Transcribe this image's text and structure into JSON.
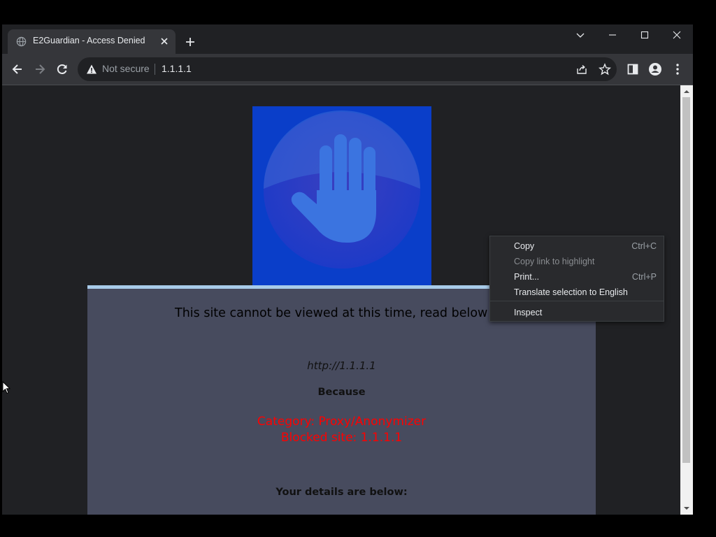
{
  "browser": {
    "tab_title": "E2Guardian - Access Denied",
    "security_status": "Not secure",
    "url": "1.1.1.1"
  },
  "page": {
    "heading": "This site cannot be viewed at this time, read below for",
    "blocked_url": "http://1.1.1.1",
    "because_label": "Because",
    "reason_category": "Category: Proxy/Anonymizer",
    "reason_site": "Blocked site: 1.1.1.1",
    "details_heading": "Your details are below:"
  },
  "context_menu": {
    "items": [
      {
        "label": "Copy",
        "shortcut": "Ctrl+C",
        "enabled": true
      },
      {
        "label": "Copy link to highlight",
        "shortcut": "",
        "enabled": false
      },
      {
        "label": "Print...",
        "shortcut": "Ctrl+P",
        "enabled": true
      },
      {
        "label": "Translate selection to English",
        "shortcut": "",
        "enabled": true
      },
      {
        "label": "Inspect",
        "shortcut": "",
        "enabled": true
      }
    ]
  },
  "colors": {
    "hero_background": "#0a3ec9",
    "card_border": "#a8cbe9",
    "reason_text": "#ff0000"
  },
  "icons": [
    "globe-icon",
    "close-icon",
    "plus-icon",
    "chevron-down-icon",
    "minimize-icon",
    "maximize-icon",
    "window-close-icon",
    "back-icon",
    "forward-icon",
    "reload-icon",
    "warning-icon",
    "share-icon",
    "star-icon",
    "side-panel-icon",
    "profile-icon",
    "menu-icon",
    "stop-hand-icon"
  ]
}
